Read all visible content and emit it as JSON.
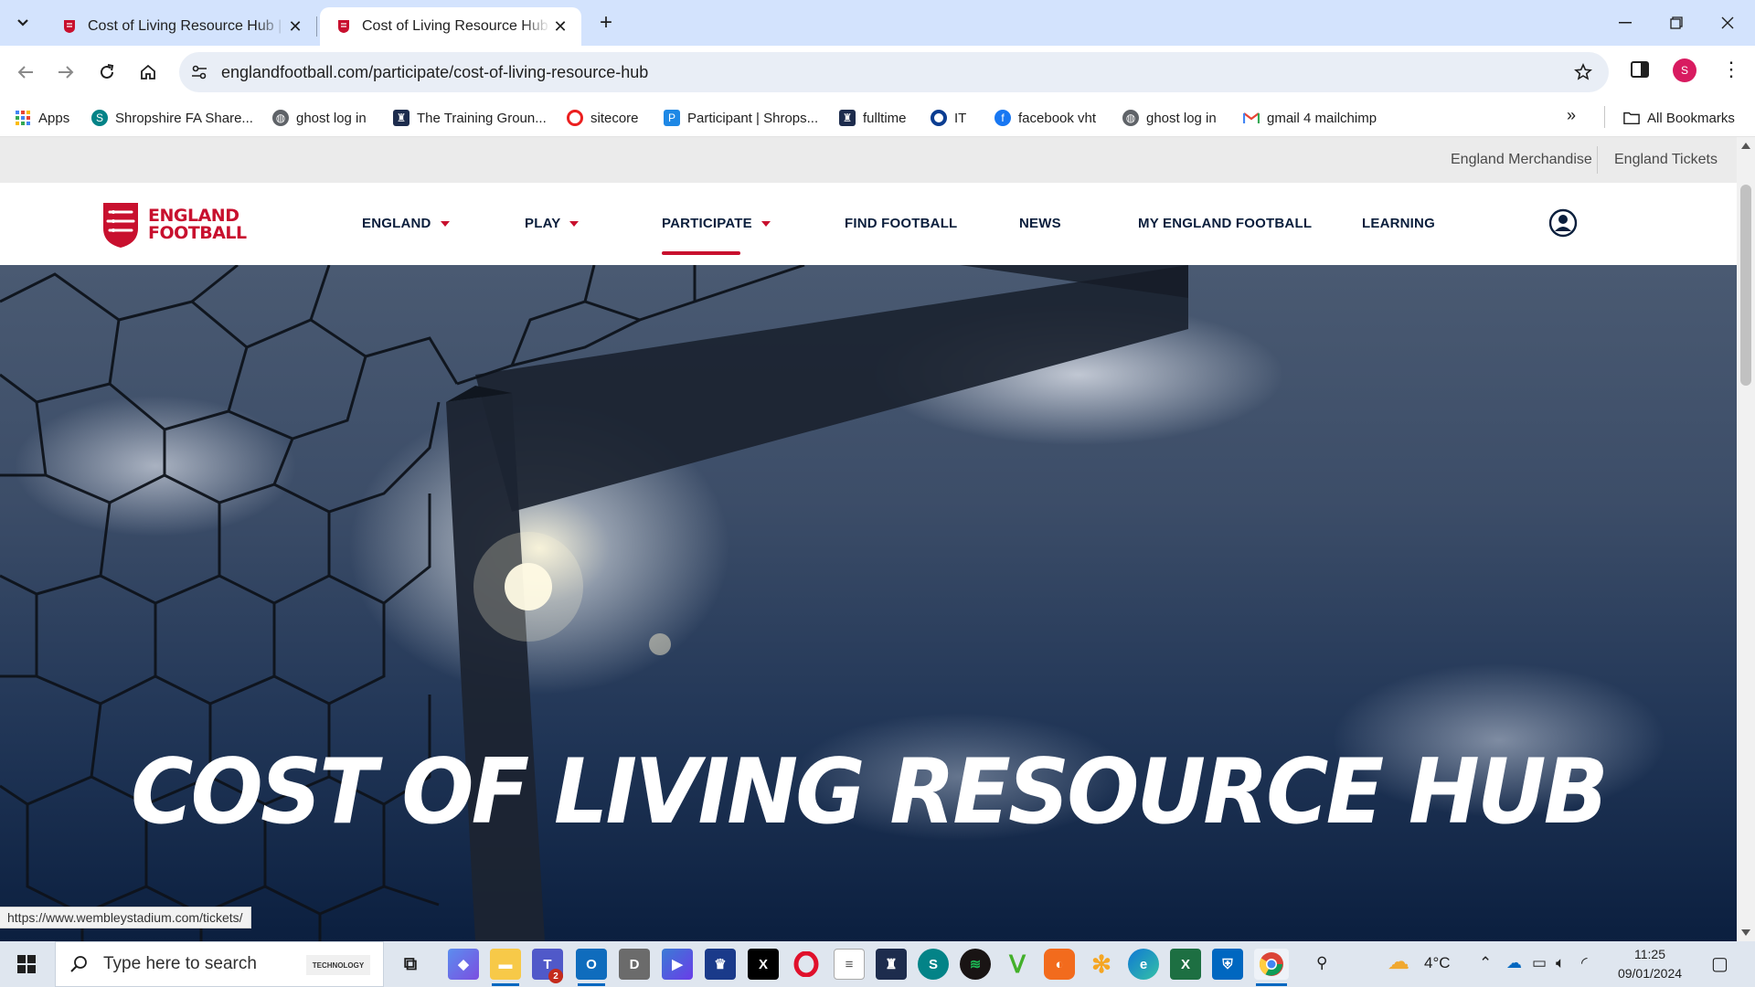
{
  "browser": {
    "tabs": [
      {
        "title": "Cost of Living Resource Hub | England Football",
        "active": false
      },
      {
        "title": "Cost of Living Resource Hub | England Football",
        "active": true
      }
    ],
    "url": "englandfootball.com/participate/cost-of-living-resource-hub",
    "profile_initial": "S",
    "bookmarks": [
      {
        "label": "Apps",
        "icon": "apps-grid-icon",
        "color": "#4285f4"
      },
      {
        "label": "Shropshire FA Share...",
        "icon": "sharepoint-icon",
        "color": "#038387"
      },
      {
        "label": "ghost log in",
        "icon": "globe-icon",
        "color": "#5f6368"
      },
      {
        "label": "The Training Groun...",
        "icon": "fa-crest-icon",
        "color": "#1d2c4d"
      },
      {
        "label": "sitecore",
        "icon": "sitecore-icon",
        "color": "#eb1f1f"
      },
      {
        "label": "Participant | Shrops...",
        "icon": "participant-icon",
        "color": "#1e88e5"
      },
      {
        "label": "fulltime",
        "icon": "fa-crest-icon",
        "color": "#1d2c4d"
      },
      {
        "label": "IT",
        "icon": "ring-icon",
        "color": "#0b3d91"
      },
      {
        "label": "facebook vht",
        "icon": "facebook-icon",
        "color": "#1877f2"
      },
      {
        "label": "ghost log in",
        "icon": "globe-icon",
        "color": "#5f6368"
      },
      {
        "label": "gmail 4 mailchimp",
        "icon": "gmail-icon",
        "color": "#ea4335"
      }
    ],
    "all_bookmarks_label": "All Bookmarks",
    "status_url": "https://www.wembleystadium.com/tickets/"
  },
  "page": {
    "utility_links": [
      "England Merchandise",
      "England Tickets"
    ],
    "logo": {
      "line1": "ENGLAND",
      "line2": "FOOTBALL",
      "color": "#c8102e"
    },
    "nav": [
      {
        "label": "ENGLAND",
        "dropdown": true
      },
      {
        "label": "PLAY",
        "dropdown": true
      },
      {
        "label": "PARTICIPATE",
        "dropdown": true,
        "active": true
      },
      {
        "label": "FIND FOOTBALL",
        "dropdown": false
      },
      {
        "label": "NEWS",
        "dropdown": false
      },
      {
        "label": "MY ENGLAND FOOTBALL",
        "dropdown": false
      },
      {
        "label": "LEARNING",
        "dropdown": false
      }
    ],
    "hero_title": "COST OF LIVING RESOURCE HUB",
    "accent_color": "#c8102e",
    "navy_color": "#0a1e3c"
  },
  "taskbar": {
    "search_placeholder": "Type here to search",
    "search_banner": "TECHNOLOGY",
    "teams_badge": "2",
    "weather": "4°C",
    "time": "11:25",
    "date": "09/01/2024"
  }
}
